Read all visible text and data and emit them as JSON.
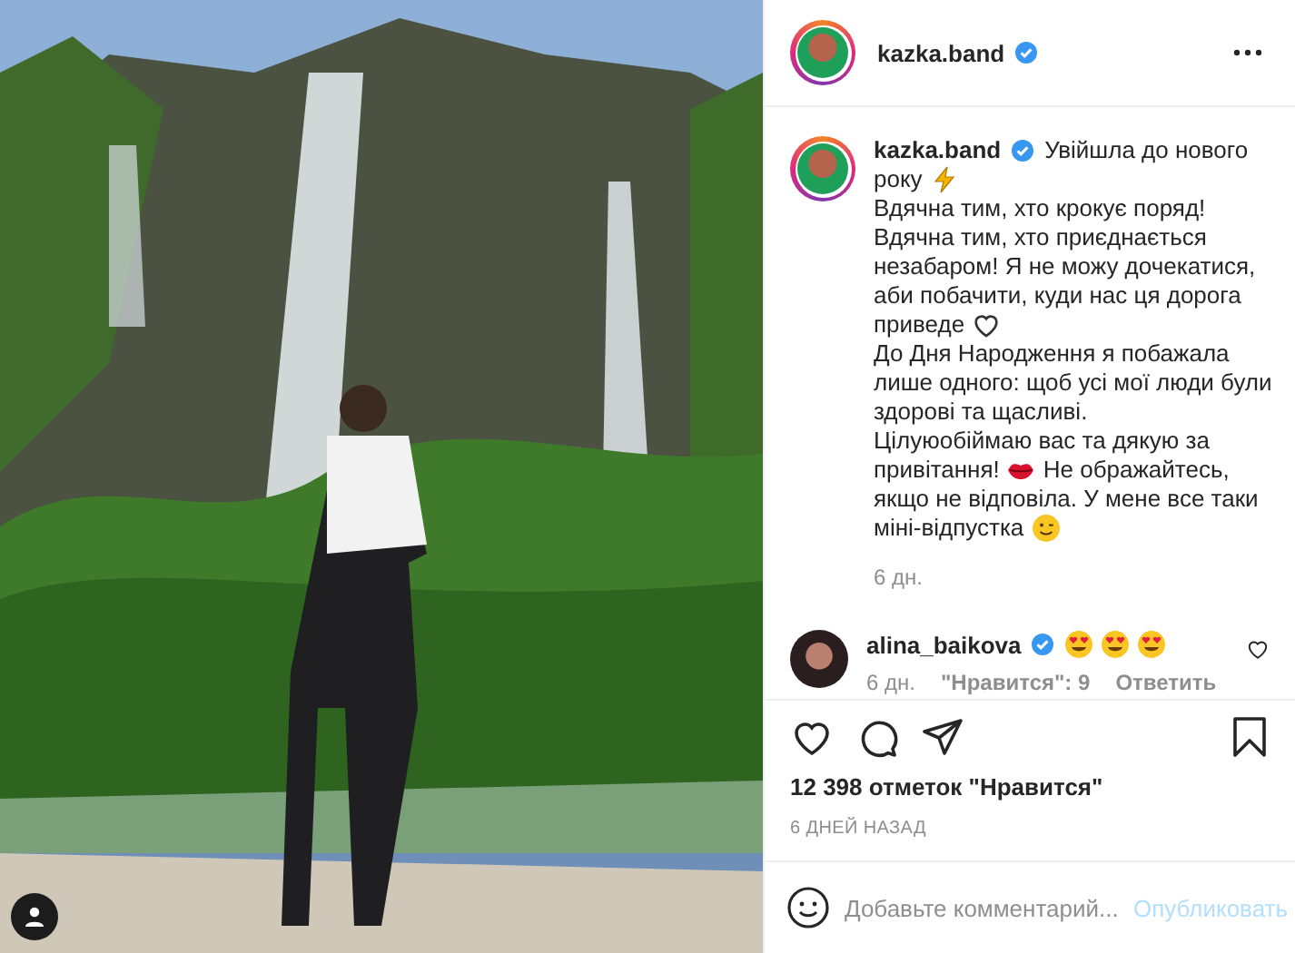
{
  "post_header": {
    "username": "kazka.band",
    "verified": true
  },
  "caption": {
    "username": "kazka.band",
    "verified": true,
    "lines": [
      {
        "parts": [
          {
            "kind": "text",
            "text": "Увійшла до нового"
          }
        ]
      },
      {
        "parts": [
          {
            "kind": "text",
            "text": "року"
          },
          {
            "kind": "lightning"
          }
        ]
      },
      {
        "parts": [
          {
            "kind": "text",
            "text": "Вдячна тим, хто крокує поряд!"
          }
        ]
      },
      {
        "parts": [
          {
            "kind": "text",
            "text": "Вдячна тим, хто приєднається"
          }
        ]
      },
      {
        "parts": [
          {
            "kind": "text",
            "text": "незабаром! Я не можу дочекатися,"
          }
        ]
      },
      {
        "parts": [
          {
            "kind": "text",
            "text": "аби побачити, куди нас ця дорога"
          }
        ]
      },
      {
        "parts": [
          {
            "kind": "text",
            "text": "приведе"
          },
          {
            "kind": "heart"
          }
        ]
      },
      {
        "parts": [
          {
            "kind": "text",
            "text": "До Дня Народження я побажала"
          }
        ]
      },
      {
        "parts": [
          {
            "kind": "text",
            "text": "лише одного: щоб усі мої люди були"
          }
        ]
      },
      {
        "parts": [
          {
            "kind": "text",
            "text": "здорові та щасливі."
          }
        ]
      },
      {
        "parts": [
          {
            "kind": "text",
            "text": "Цілуюобіймаю вас та дякую за"
          }
        ]
      },
      {
        "parts": [
          {
            "kind": "text",
            "text": "привітання!"
          },
          {
            "kind": "lips"
          },
          {
            "kind": "text",
            "text": "Не ображайтесь,"
          }
        ]
      },
      {
        "parts": [
          {
            "kind": "text",
            "text": "якщо не відповіла. У мене все таки"
          }
        ]
      },
      {
        "parts": [
          {
            "kind": "text",
            "text": "міні-відпустка"
          },
          {
            "kind": "wink"
          }
        ]
      }
    ],
    "time": "6 дн."
  },
  "comments": [
    {
      "username": "alina_baikova",
      "verified": true,
      "parts": [
        {
          "kind": "heart_eyes"
        },
        {
          "kind": "heart_eyes"
        },
        {
          "kind": "heart_eyes"
        }
      ],
      "time": "6 дн.",
      "likes": "\"Нравится\": 9",
      "reply": "Ответить",
      "liked": false
    }
  ],
  "likes": "12 398 отметок \"Нравится\"",
  "date": "6 ДНЕЙ НАЗАД",
  "comment_box": {
    "placeholder": "Добавьте комментарий...",
    "submit": "Опубликовать"
  },
  "actions": {
    "liked": false,
    "saved": false
  }
}
